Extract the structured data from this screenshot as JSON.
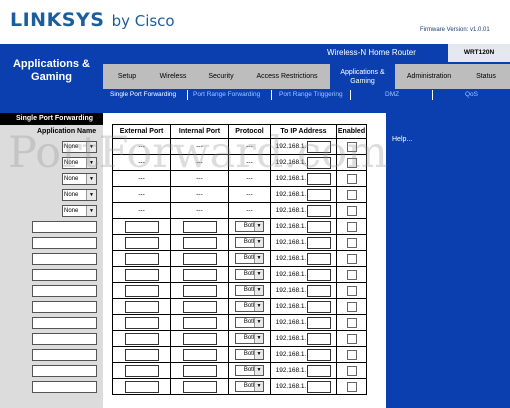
{
  "header": {
    "brand": "LINKSYS",
    "by": "by Cisco",
    "firmware": "Firmware Version: v1.0.01",
    "product_name": "Wireless-N Home Router",
    "model": "WRT120N"
  },
  "section_title": "Applications & Gaming",
  "tabs": [
    {
      "label": "Setup"
    },
    {
      "label": "Wireless"
    },
    {
      "label": "Security"
    },
    {
      "label": "Access Restrictions"
    },
    {
      "label": "Applications & Gaming"
    },
    {
      "label": "Administration"
    },
    {
      "label": "Status"
    }
  ],
  "subtabs": [
    {
      "label": "Single Port Forwarding"
    },
    {
      "label": "Port Range Forwarding"
    },
    {
      "label": "Port Range Triggering"
    },
    {
      "label": "DMZ"
    },
    {
      "label": "QoS"
    }
  ],
  "left": {
    "section": "Single Port Forwarding",
    "col_header": "Application Name"
  },
  "table": {
    "headers": [
      "External Port",
      "Internal Port",
      "Protocol",
      "To IP Address",
      "Enabled"
    ],
    "dash": "---",
    "ip_prefix": "192.168.1.",
    "protocol_default": "Both",
    "app_default": "None"
  },
  "help": {
    "label": "Help..."
  },
  "watermark": "PortForward.com"
}
